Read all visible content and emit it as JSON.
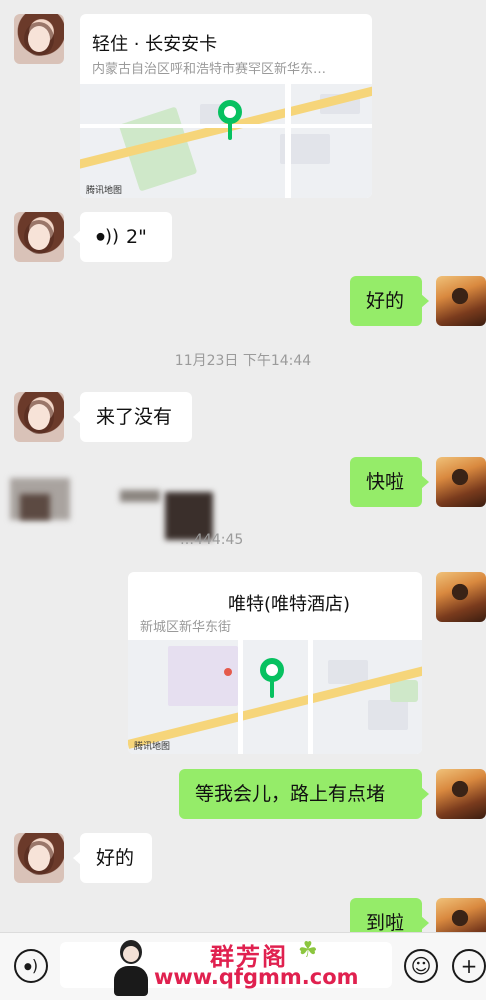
{
  "messages": {
    "loc1": {
      "title": "轻住 · 长安安卡",
      "address": "内蒙古自治区呼和浩特市赛罕区新华东…",
      "map_credit": "腾讯地图"
    },
    "voice": {
      "duration": "2\""
    },
    "reply_ok_1": "好的",
    "timestamp": "11月23日 下午14:44",
    "came_yet": "来了没有",
    "almost": "快啦",
    "blurred_time": "…444:45",
    "loc2": {
      "title": "唯特(唯特酒店)",
      "address": "新城区新华东街",
      "map_credit": "腾讯地图"
    },
    "wait": "等我会儿，路上有点堵",
    "reply_ok_2": "好的",
    "arrived": "到啦"
  },
  "toolbar": {
    "voice_icon": "voice-icon",
    "emoji_icon": "emoji-icon",
    "plus_icon": "plus-icon"
  },
  "watermark": {
    "brand": "群芳阁",
    "url": "www.qfgmm.com"
  },
  "colors": {
    "background": "#ededed",
    "bubble_green": "#95ec69",
    "bubble_white": "#ffffff",
    "pin_green": "#07c160",
    "watermark_red": "#e0214f"
  }
}
